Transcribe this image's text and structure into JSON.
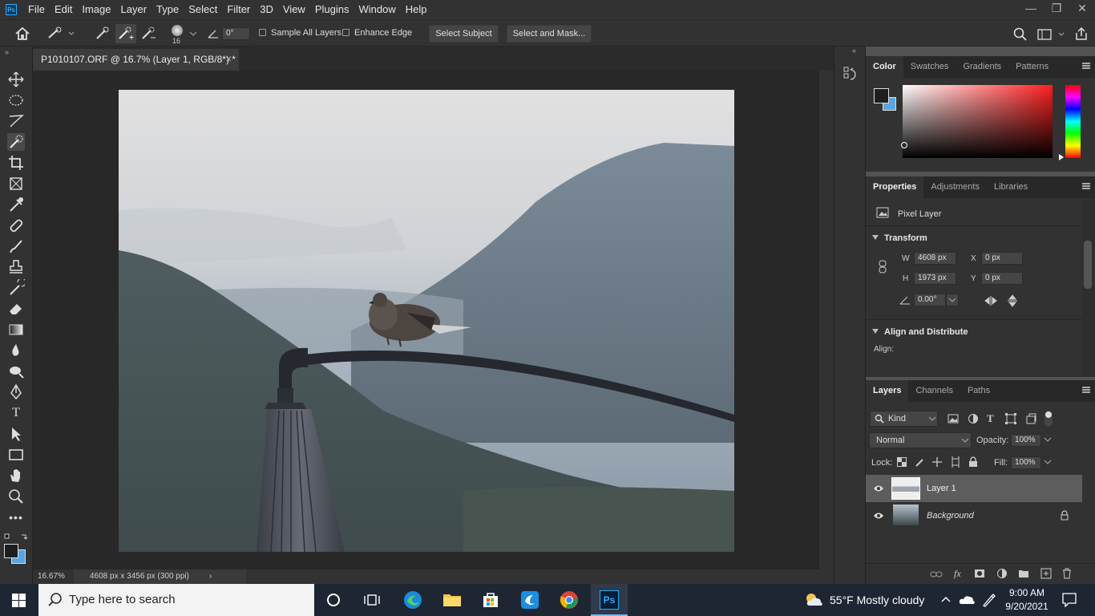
{
  "menubar": {
    "app_logo": "Ps",
    "items": [
      "File",
      "Edit",
      "Image",
      "Layer",
      "Type",
      "Select",
      "Filter",
      "3D",
      "View",
      "Plugins",
      "Window",
      "Help"
    ],
    "window_controls": {
      "minimize": "—",
      "restore": "❐",
      "close": "✕"
    }
  },
  "options": {
    "brush_size": "16",
    "angle_value": "0°",
    "sample_all_layers": "Sample All Layers",
    "enhance_edge": "Enhance Edge",
    "select_subject": "Select Subject",
    "select_and_mask": "Select and Mask..."
  },
  "document": {
    "tab_title": "P1010107.ORF @ 16.7% (Layer 1, RGB/8*) *",
    "close": "✕",
    "zoom": "16.67%",
    "size_info": "4608 px x 3456 px (300 ppi)",
    "status_arrow": "›"
  },
  "color_panel": {
    "tabs": [
      "Color",
      "Swatches",
      "Gradients",
      "Patterns"
    ],
    "foreground": "#1e1e1e",
    "background": "#5ba4e0",
    "hue": "#ff1e1e"
  },
  "properties_panel": {
    "tabs": [
      "Properties",
      "Adjustments",
      "Libraries"
    ],
    "layer_type": "Pixel Layer",
    "transform_title": "Transform",
    "w_label": "W",
    "w_value": "4608 px",
    "h_label": "H",
    "h_value": "1973 px",
    "x_label": "X",
    "x_value": "0 px",
    "y_label": "Y",
    "y_value": "0 px",
    "angle_value": "0.00°",
    "align_title": "Align and Distribute",
    "align_label": "Align:"
  },
  "layers_panel": {
    "tabs": [
      "Layers",
      "Channels",
      "Paths"
    ],
    "filter_kind": "Kind",
    "blend_mode": "Normal",
    "opacity_label": "Opacity:",
    "opacity_value": "100%",
    "lock_label": "Lock:",
    "fill_label": "Fill:",
    "fill_value": "100%",
    "layers": [
      {
        "name": "Layer 1",
        "selected": true
      },
      {
        "name": "Background",
        "locked": true
      }
    ],
    "footer_fx": "fx"
  },
  "taskbar": {
    "search_placeholder": "Type here to search",
    "weather": "55°F  Mostly cloudy",
    "time": "9:00 AM",
    "date": "9/20/2021"
  }
}
